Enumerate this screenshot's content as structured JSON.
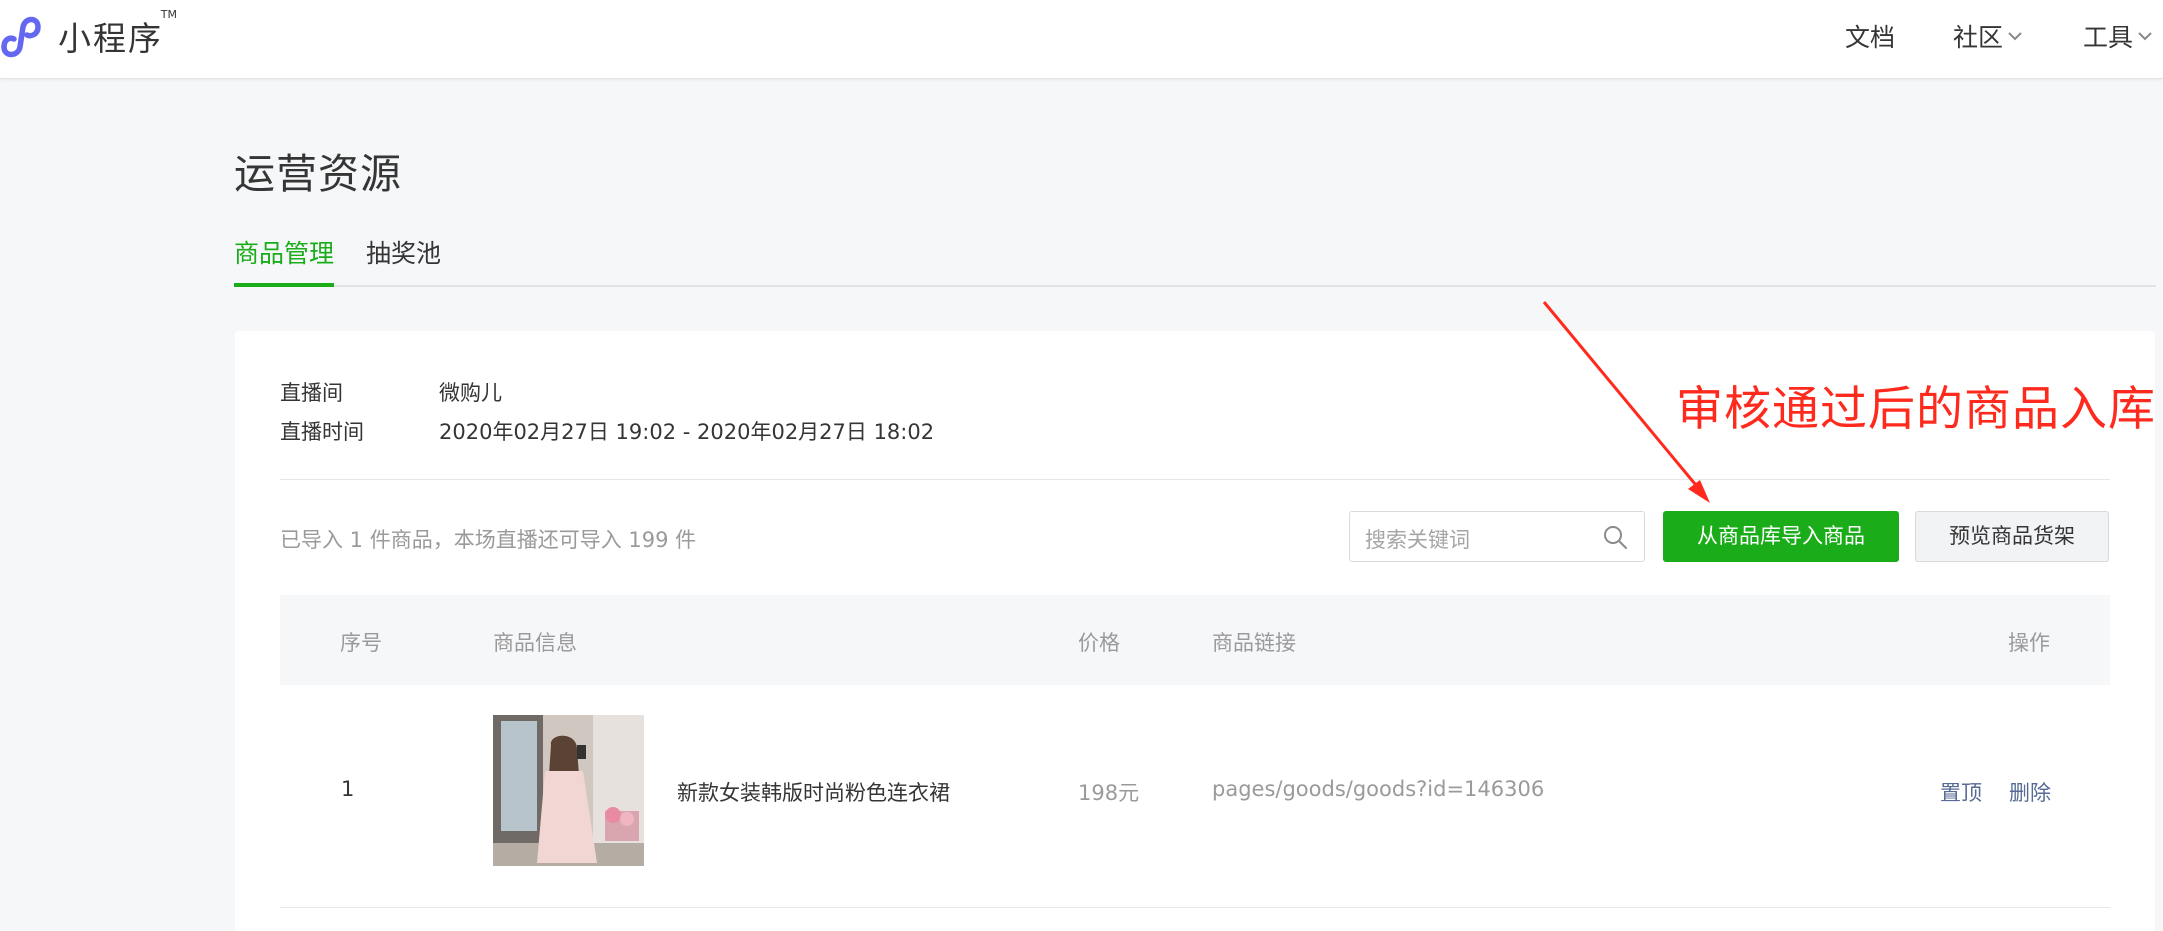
{
  "header": {
    "brand": "小程序",
    "brand_tm": "TM",
    "nav": [
      {
        "label": "文档"
      },
      {
        "label": "社区"
      },
      {
        "label": "工具"
      }
    ]
  },
  "page": {
    "title": "运营资源",
    "tabs": [
      {
        "label": "商品管理",
        "active": true
      },
      {
        "label": "抽奖池",
        "active": false
      }
    ]
  },
  "live": {
    "room_label": "直播间",
    "room_value": "微购儿",
    "time_label": "直播时间",
    "time_value": "2020年02月27日 19:02 - 2020年02月27日 18:02"
  },
  "toolbar": {
    "count_text": "已导入 1 件商品，本场直播还可导入 199 件",
    "search_placeholder": "搜索关键词",
    "import_label": "从商品库导入商品",
    "preview_label": "预览商品货架"
  },
  "table": {
    "columns": [
      "序号",
      "商品信息",
      "价格",
      "商品链接",
      "操作"
    ],
    "rows": [
      {
        "index": "1",
        "name": "新款女装韩版时尚粉色连衣裙",
        "price": "198元",
        "link": "pages/goods/goods?id=146306",
        "actions": [
          "置顶",
          "删除"
        ]
      }
    ]
  },
  "annotation": {
    "text": "审核通过后的商品入库"
  },
  "colors": {
    "accent": "#1aad19",
    "link": "#576b95",
    "annotation": "#ff2a1e",
    "logo": "#6467f0"
  },
  "icons": [
    "miniprogram-logo-icon",
    "chevron-down-icon",
    "search-icon"
  ]
}
